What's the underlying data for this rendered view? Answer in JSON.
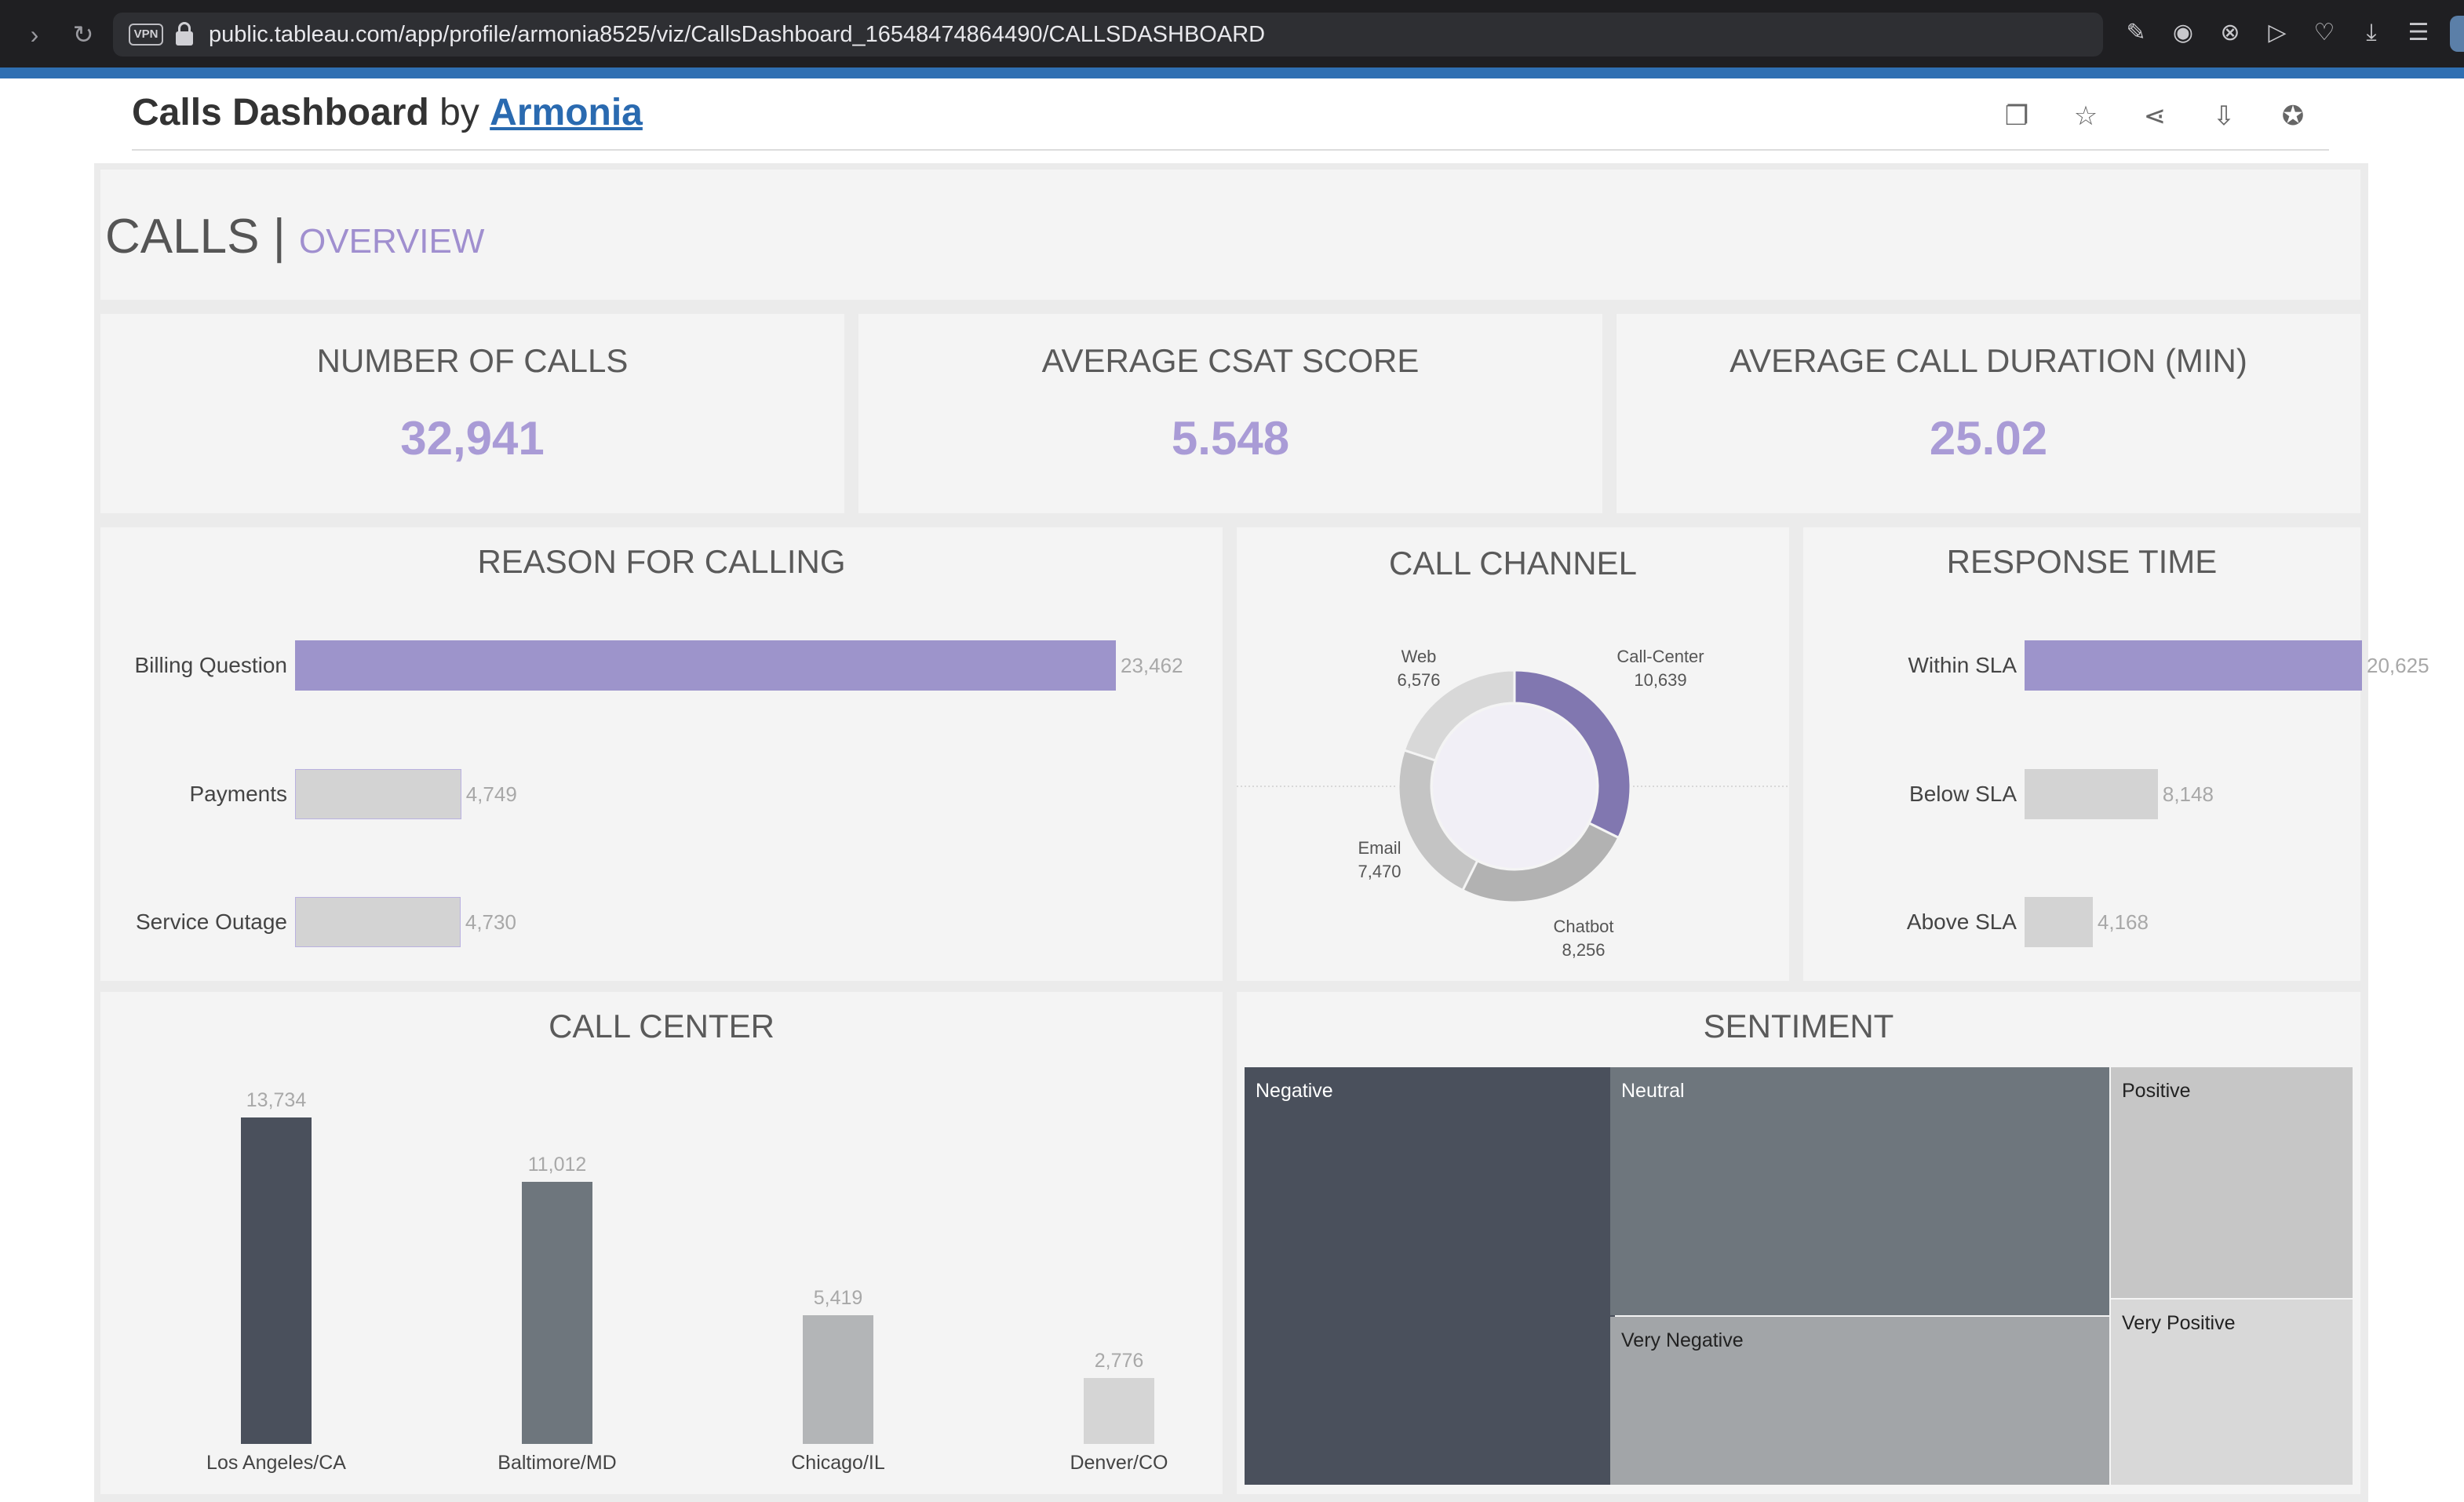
{
  "browser": {
    "url": "public.tableau.com/app/profile/armonia8525/viz/CallsDashboard_16548474864490/CALLSDASHBOARD",
    "vpn_label": "VPN"
  },
  "header": {
    "title": "Calls Dashboard",
    "by": "by",
    "author": "Armonia"
  },
  "dashboard": {
    "title": "CALLS",
    "separator": "|",
    "subtitle": "OVERVIEW"
  },
  "kpis": [
    {
      "title": "NUMBER OF CALLS",
      "value": "32,941"
    },
    {
      "title": "AVERAGE CSAT SCORE",
      "value": "5.548"
    },
    {
      "title": "AVERAGE CALL DURATION (MIN)",
      "value": "25.02"
    }
  ],
  "chart_data": [
    {
      "title": "REASON FOR CALLING",
      "type": "bar",
      "orientation": "horizontal",
      "categories": [
        "Billing Question",
        "Payments",
        "Service Outage"
      ],
      "values": [
        23462,
        4749,
        4730
      ],
      "value_labels": [
        "23,462",
        "4,749",
        "4,730"
      ],
      "colors": [
        "#9d94cb",
        "#d3d3d3",
        "#d3d3d3"
      ]
    },
    {
      "title": "CALL CHANNEL",
      "type": "pie",
      "donut": true,
      "categories": [
        "Call-Center",
        "Chatbot",
        "Email",
        "Web"
      ],
      "values": [
        10639,
        8256,
        7470,
        6576
      ],
      "value_labels": [
        "10,639",
        "8,256",
        "7,470",
        "6,576"
      ],
      "colors": [
        "#8177b0",
        "#b2b2b2",
        "#c4c4c4",
        "#d8d8d8"
      ]
    },
    {
      "title": "RESPONSE TIME",
      "type": "bar",
      "orientation": "horizontal",
      "categories": [
        "Within SLA",
        "Below SLA",
        "Above SLA"
      ],
      "values": [
        20625,
        8148,
        4168
      ],
      "value_labels": [
        "20,625",
        "8,148",
        "4,168"
      ],
      "colors": [
        "#9d94cb",
        "#d3d3d3",
        "#d3d3d3"
      ]
    },
    {
      "title": "CALL CENTER",
      "type": "bar",
      "orientation": "vertical",
      "categories": [
        "Los Angeles/CA",
        "Baltimore/MD",
        "Chicago/IL",
        "Denver/CO"
      ],
      "values": [
        13734,
        11012,
        5419,
        2776
      ],
      "value_labels": [
        "13,734",
        "11,012",
        "5,419",
        "2,776"
      ],
      "colors": [
        "#4a505c",
        "#6e767d",
        "#b3b5b7",
        "#d5d5d5"
      ]
    },
    {
      "title": "SENTIMENT",
      "type": "heatmap",
      "variant": "treemap",
      "categories": [
        "Negative",
        "Neutral",
        "Very Negative",
        "Positive",
        "Very Positive"
      ],
      "colors": [
        "#4a505c",
        "#6e767d",
        "#a2a5a8",
        "#c6c6c6",
        "#d8d8d8"
      ]
    }
  ]
}
